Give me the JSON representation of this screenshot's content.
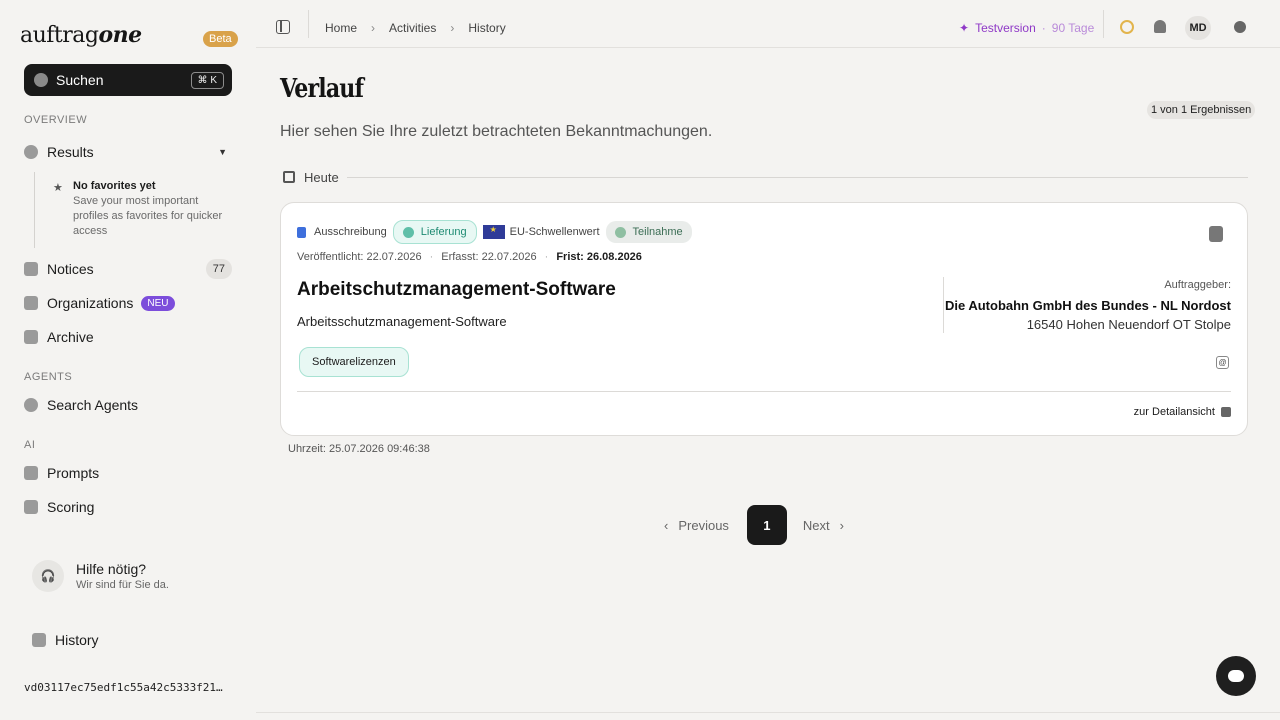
{
  "sidebar": {
    "logo_regular": "auftrag",
    "logo_bold": "one",
    "beta": "Beta",
    "search_label": "Suchen",
    "search_shortcut": "⌘ K",
    "overview_label": "OVERVIEW",
    "results_label": "Results",
    "fav_title": "No favorites yet",
    "fav_desc": "Save your most important profiles as favorites for quicker access",
    "notices_label": "Notices",
    "notices_count": "77",
    "organizations_label": "Organizations",
    "organizations_badge": "NEU",
    "archive_label": "Archive",
    "agents_label": "AGENTS",
    "search_agents_label": "Search Agents",
    "ai_label": "AI",
    "prompts_label": "Prompts",
    "scoring_label": "Scoring",
    "help_title": "Hilfe nötig?",
    "help_sub": "Wir sind für Sie da.",
    "history_label": "History",
    "hash": "vd03117ec75edf1c55a42c5333f21…"
  },
  "topbar": {
    "crumbs": [
      "Home",
      "Activities",
      "History"
    ],
    "trial_label": "Testversion",
    "trial_days": "90 Tage",
    "avatar": "MD"
  },
  "main": {
    "title": "Verlauf",
    "subtitle": "Hier sehen Sie Ihre zuletzt betrachteten Bekanntmachungen.",
    "results": "1 von 1 Ergebnissen",
    "day": "Heute"
  },
  "card": {
    "type": "Ausschreibung",
    "lieferung": "Lieferung",
    "eu": "EU-Schwellenwert",
    "teilnahme": "Teilnahme",
    "published": "Veröffentlicht: 22.07.2026",
    "captured": "Erfasst: 22.07.2026",
    "deadline": "Frist: 26.08.2026",
    "title": "Arbeitschutzmanagement-Software",
    "description": "Arbeitsschutzmanagement-Software",
    "client_label": "Auftraggeber:",
    "client_name": "Die Autobahn GmbH des Bundes - NL Nordost",
    "client_address": "16540 Hohen Neuendorf OT Stolpe",
    "cpv": "Softwarelizenzen",
    "detail": "zur Detailansicht",
    "time": "Uhrzeit: 25.07.2026 09:46:38"
  },
  "pager": {
    "previous": "Previous",
    "current": "1",
    "next": "Next"
  },
  "colors": {
    "accent_purple": "#8f39c7",
    "beta_orange": "#d9a24a",
    "green_tag": "#1f8b73"
  }
}
